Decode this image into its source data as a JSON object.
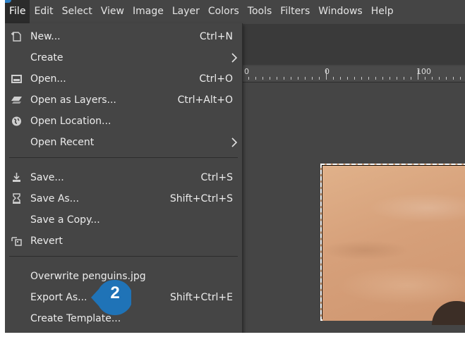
{
  "menubar": {
    "items": [
      "File",
      "Edit",
      "Select",
      "View",
      "Image",
      "Layer",
      "Colors",
      "Tools",
      "Filters",
      "Windows",
      "Help"
    ],
    "active": "File"
  },
  "ruler": {
    "labels": [
      "0",
      "0",
      "100"
    ]
  },
  "file_menu": {
    "items": [
      {
        "label": "New...",
        "shortcut": "Ctrl+N",
        "icon": "new-page-icon"
      },
      {
        "label": "Create",
        "submenu": true
      },
      {
        "label": "Open...",
        "shortcut": "Ctrl+O",
        "icon": "open-image-icon"
      },
      {
        "label": "Open as Layers...",
        "shortcut": "Ctrl+Alt+O",
        "icon": "layers-icon"
      },
      {
        "label": "Open Location...",
        "icon": "globe-icon"
      },
      {
        "label": "Open Recent",
        "submenu": true
      },
      {
        "label": "Save...",
        "shortcut": "Ctrl+S",
        "icon": "save-icon"
      },
      {
        "label": "Save As...",
        "shortcut": "Shift+Ctrl+S",
        "icon": "save-as-icon"
      },
      {
        "label": "Save a Copy..."
      },
      {
        "label": "Revert",
        "icon": "revert-icon"
      },
      {
        "label": "Overwrite penguins.jpg"
      },
      {
        "label": "Export As...",
        "shortcut": "Shift+Ctrl+E"
      },
      {
        "label": "Create Template..."
      }
    ]
  },
  "callout": {
    "number": "2",
    "color": "#1f73b7"
  },
  "colors": {
    "menu_bg": "#454545",
    "active_menu_bg": "#2b2b2b",
    "text": "#ececec",
    "sand": "#d9a77f"
  }
}
